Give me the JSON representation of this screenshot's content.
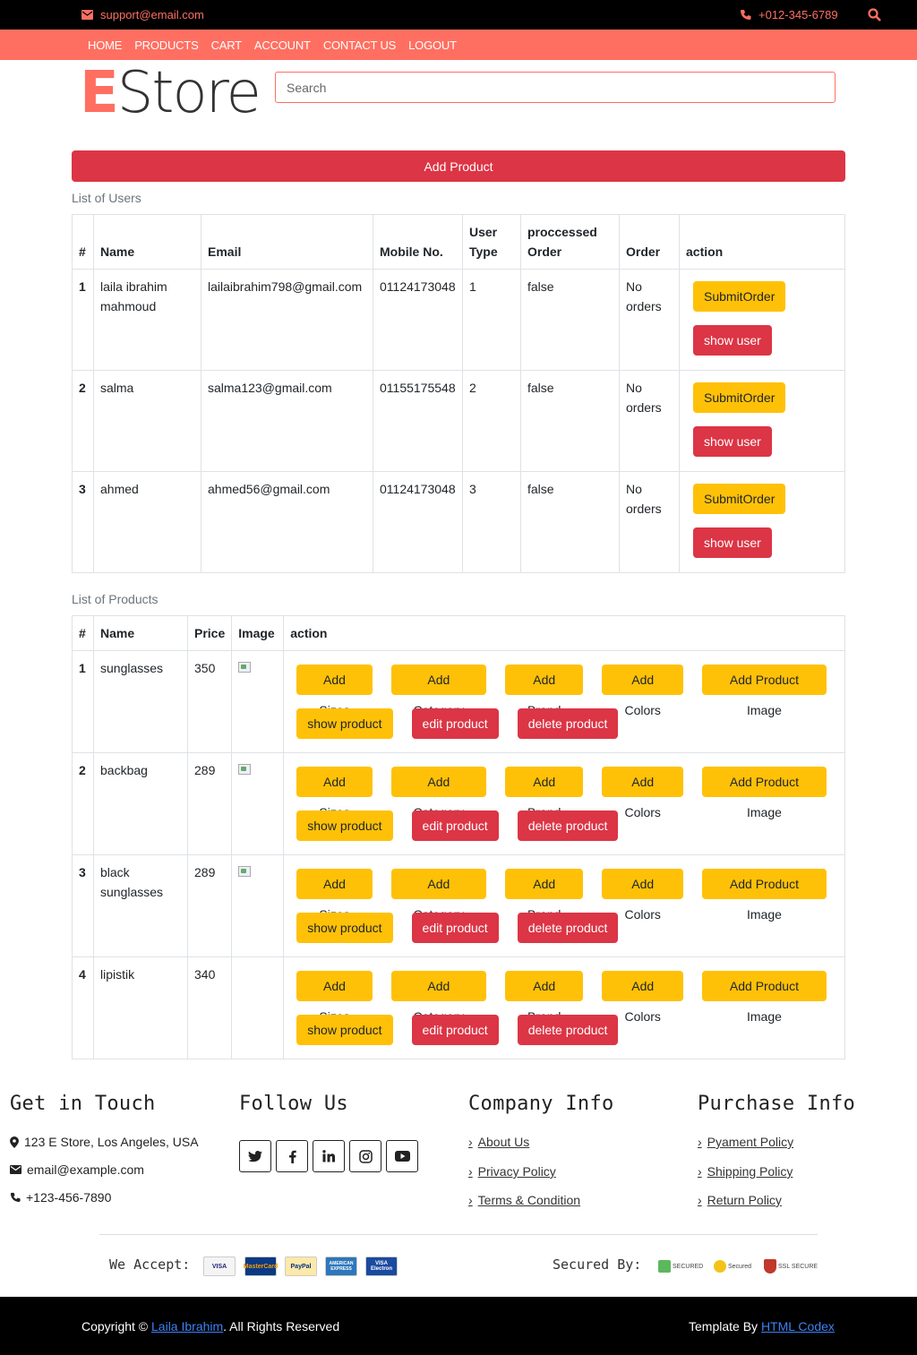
{
  "topbar": {
    "email": "support@email.com",
    "phone": "+012-345-6789"
  },
  "nav": [
    "HOME",
    "PRODUCTS",
    "CART",
    "ACCOUNT",
    "CONTACT US",
    "LOGOUT"
  ],
  "logo": {
    "e": "E",
    "rest": "Store"
  },
  "search": {
    "placeholder": "Search"
  },
  "add_product_label": "Add Product",
  "users": {
    "caption": "List of Users",
    "headers": [
      "#",
      "Name",
      "Email",
      "Mobile No.",
      "User Type",
      "proccessed Order",
      "Order",
      "action"
    ],
    "rows": [
      {
        "idx": "1",
        "name": "laila ibrahim mahmoud",
        "email": "lailaibrahim798@gmail.com",
        "mobile": "01124173048",
        "type": "1",
        "processed": "false",
        "order": "No orders"
      },
      {
        "idx": "2",
        "name": "salma",
        "email": "salma123@gmail.com",
        "mobile": "01155175548",
        "type": "2",
        "processed": "false",
        "order": "No orders"
      },
      {
        "idx": "3",
        "name": "ahmed",
        "email": "ahmed56@gmail.com",
        "mobile": "01124173048",
        "type": "3",
        "processed": "false",
        "order": "No orders"
      }
    ],
    "submit_label": "SubmitOrder",
    "show_label": "show user"
  },
  "products": {
    "caption": "List of Products",
    "headers": [
      "#",
      "Name",
      "Price",
      "Image",
      "action"
    ],
    "rows": [
      {
        "idx": "1",
        "name": "sunglasses",
        "price": "350",
        "has_image": true
      },
      {
        "idx": "2",
        "name": "backbag",
        "price": "289",
        "has_image": true
      },
      {
        "idx": "3",
        "name": "black sunglasses",
        "price": "289",
        "has_image": true
      },
      {
        "idx": "4",
        "name": "lipistik",
        "price": "340",
        "has_image": false
      }
    ],
    "actions_row1": [
      "Add Sizes",
      "Add Category",
      "Add Brand",
      "Add Colors",
      "Add Product Image"
    ],
    "actions_row2": [
      "show product",
      "edit product",
      "delete product"
    ]
  },
  "footer": {
    "get_in_touch": {
      "title": "Get in Touch",
      "address": "123 E Store, Los Angeles, USA",
      "email": "email@example.com",
      "phone": "+123-456-7890"
    },
    "follow": {
      "title": "Follow Us",
      "icons": [
        "twitter-icon",
        "facebook-icon",
        "linkedin-icon",
        "instagram-icon",
        "youtube-icon"
      ]
    },
    "company": {
      "title": "Company Info",
      "links": [
        "About Us",
        "Privacy Policy",
        "Terms & Condition"
      ]
    },
    "purchase": {
      "title": "Purchase Info",
      "links": [
        "Pyament Policy",
        "Shipping Policy",
        "Return Policy"
      ]
    },
    "accept_label": "We Accept:",
    "cards": [
      "VISA",
      "MasterCard",
      "PayPal",
      "AMERICAN EXPRESS",
      "VISA Electron"
    ],
    "secured_label": "Secured By:",
    "badges": [
      "SECURED",
      "Secured",
      "SSL SECURE"
    ]
  },
  "bottom": {
    "copy_prefix": "Copyright ©",
    "copy_name": "Laila Ibrahim",
    "copy_suffix": ". All Rights Reserved",
    "template_prefix": "Template By",
    "template_name": "HTML Codex"
  },
  "colors": {
    "accent": "#FF6F61",
    "danger": "#DC3545",
    "warning": "#FFC107"
  }
}
